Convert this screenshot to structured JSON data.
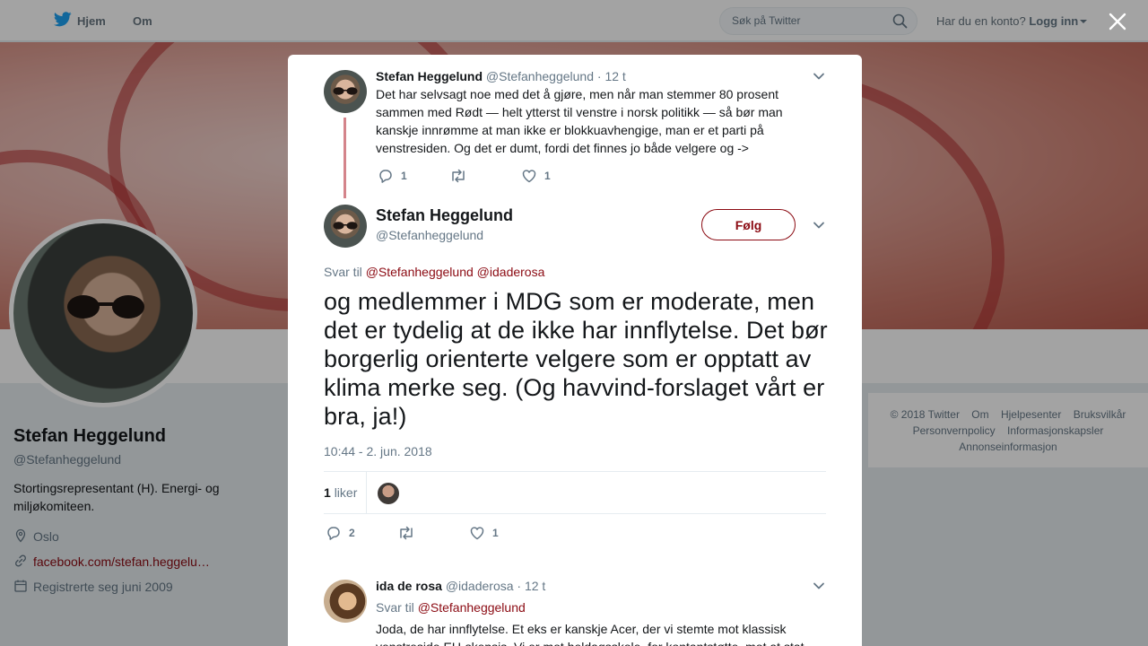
{
  "nav": {
    "home_label": "Hjem",
    "about_label": "Om",
    "search_placeholder": "Søk på Twitter",
    "account_prompt": "Har du en konto?",
    "login_label": "Logg inn"
  },
  "profile": {
    "name": "Stefan Heggelund",
    "handle": "@Stefanheggelund",
    "bio": "Stortingsrepresentant (H). Energi- og miljøkomiteen.",
    "location": "Oslo",
    "link": "facebook.com/stefan.heggelu…",
    "joined": "Registrerte seg juni 2009"
  },
  "footer": {
    "links": [
      "© 2018 Twitter",
      "Om",
      "Hjelpesenter",
      "Bruksvilkår",
      "Personvernpolicy",
      "Informasjonskapsler",
      "Annonseinformasjon"
    ]
  },
  "modal": {
    "parent_tweet": {
      "name": "Stefan Heggelund",
      "handle": "@Stefanheggelund",
      "time": "· 12 t",
      "text": "Det har selvsagt noe med det å gjøre, men når man stemmer 80 prosent sammen med Rødt — helt ytterst til venstre i norsk politikk — så bør man kanskje innrømme at man ikke er blokkuavhengige, man er et parti på venstresiden. Og det er dumt, fordi det finnes jo både velgere og ->",
      "replies": "1",
      "retweets": "",
      "likes": "1"
    },
    "main_tweet": {
      "name": "Stefan Heggelund",
      "handle": "@Stefanheggelund",
      "follow_label": "Følg",
      "reply_prefix": "Svar til",
      "reply_mention_1": "@Stefanheggelund",
      "reply_mention_2": "@idaderosa",
      "text": "og medlemmer i MDG som er moderate, men det er tydelig at de ikke har innflytelse. Det bør borgerlig orienterte velgere som er opptatt av klima merke seg. (Og havvind-forslaget vårt er bra, ja!)",
      "timestamp": "10:44 - 2. jun. 2018",
      "likes_count": "1",
      "likes_label": "liker",
      "replies": "2",
      "retweets": "",
      "likes": "1"
    },
    "reply_tweet": {
      "name": "ida de rosa",
      "handle": "@idaderosa",
      "time": "· 12 t",
      "reply_prefix": "Svar til",
      "reply_mention": "@Stefanheggelund",
      "text": "Joda, de har innflytelse. Et eks er kanskje Acer, der vi stemte mot klassisk venstreside EU-skepsis. Vi er mot heldagsskole, for kontantstøtte, mot at stat"
    }
  },
  "colors": {
    "accent": "#8b0a12",
    "twitter_blue": "#1da1f2",
    "thread_line": "#d4848b",
    "muted_text": "#657786"
  }
}
